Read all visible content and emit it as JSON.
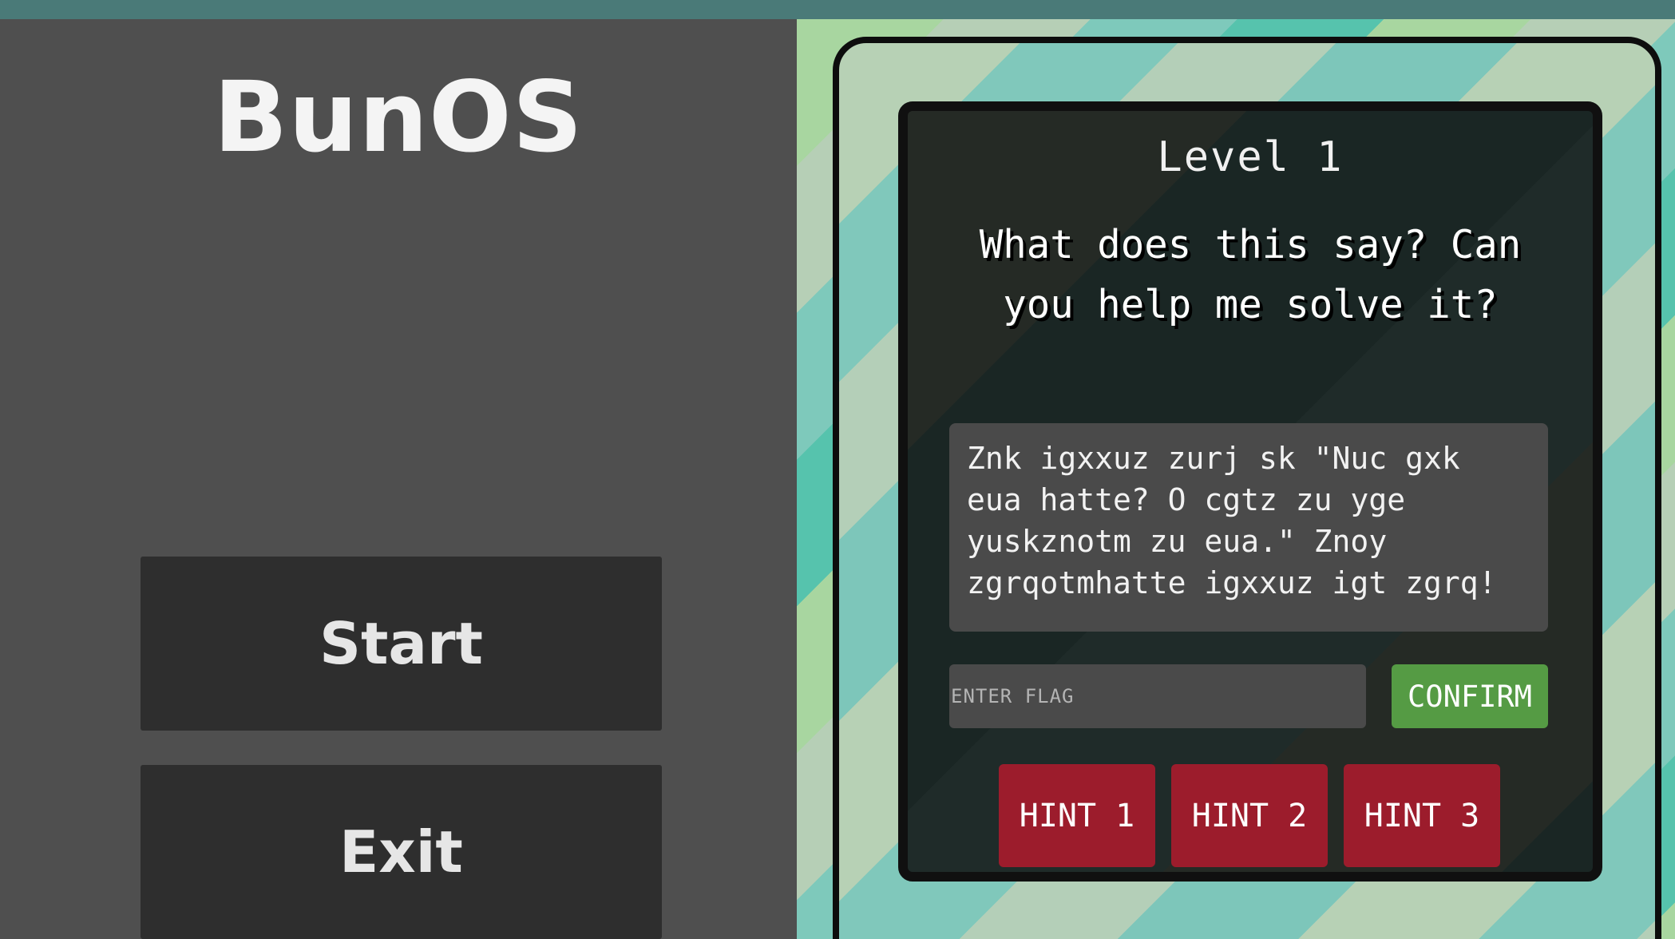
{
  "app": {
    "title": "BunOS"
  },
  "menu": {
    "start_label": "Start",
    "exit_label": "Exit"
  },
  "puzzle": {
    "level_label": "Level 1",
    "prompt": "What does this say? Can you help me solve it?",
    "ciphertext": "Znk igxxuz zurj sk \"Nuc gxk eua hatte? O cgtz zu yge yuskznotm zu eua.\" Znoy zgrqotmhatte igxxuz igt zgrq!",
    "flag_placeholder": "ENTER FLAG",
    "flag_value": "",
    "confirm_label": "CONFIRM",
    "hints": [
      {
        "label": "HINT 1"
      },
      {
        "label": "HINT 2"
      },
      {
        "label": "HINT 3"
      }
    ]
  },
  "colors": {
    "left_panel_bg": "#4f4f4f",
    "menu_button_bg": "#2e2e2e",
    "confirm_green": "#559b44",
    "hint_red": "#9c1c2c",
    "topbar": "#4a7a78"
  }
}
